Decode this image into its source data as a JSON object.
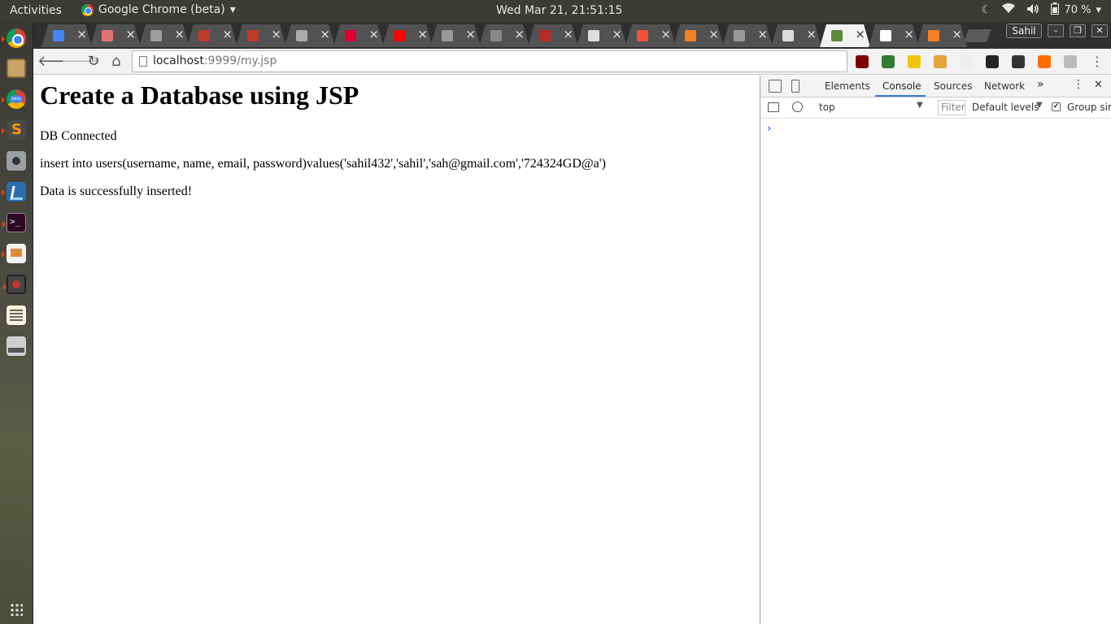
{
  "topbar": {
    "activities": "Activities",
    "app_name": "Google Chrome (beta)",
    "app_menu_arrow": "▾",
    "clock": "Wed Mar 21, 21:51:15",
    "battery": "70 %",
    "tray_arrow": "▾"
  },
  "launcher": {
    "icons": [
      "chrome-icon",
      "files-icon",
      "chrome-beta-icon",
      "sublime-text-icon",
      "camera-icon",
      "vscode-icon",
      "terminal-icon",
      "document-viewer-icon",
      "screen-recorder-icon",
      "text-editor-icon",
      "scanner-icon",
      "show-applications-icon"
    ]
  },
  "browser": {
    "profile_name": "Sahil",
    "tab_close": "×",
    "tabs": [
      {
        "icon": "google-icon",
        "color": "#4285f4"
      },
      {
        "icon": "target-icon",
        "color": "#e57373"
      },
      {
        "icon": "page-icon",
        "color": "#9e9e9e"
      },
      {
        "icon": "netbeans-icon",
        "color": "#c0392b"
      },
      {
        "icon": "netbeans-icon",
        "color": "#c0392b"
      },
      {
        "icon": "vector-icon",
        "color": "#aaaaaa"
      },
      {
        "icon": "angular-icon",
        "color": "#dd0031"
      },
      {
        "icon": "youtube-icon",
        "color": "#ff0000"
      },
      {
        "icon": "codepen-icon",
        "color": "#999999"
      },
      {
        "icon": "spotify-icon",
        "color": "#888888"
      },
      {
        "icon": "quora-icon",
        "color": "#b92b27"
      },
      {
        "icon": "page-icon",
        "color": "#dddddd"
      },
      {
        "icon": "swift-icon",
        "color": "#f05138"
      },
      {
        "icon": "stackoverflow-icon",
        "color": "#f48024"
      },
      {
        "icon": "codepen-icon",
        "color": "#999999"
      },
      {
        "icon": "page-icon",
        "color": "#dddddd"
      },
      {
        "icon": "image-icon",
        "color": "#5d8b3a",
        "active": true
      },
      {
        "icon": "github-icon",
        "color": "#ffffff"
      },
      {
        "icon": "stackoverflow-icon",
        "color": "#f48024"
      }
    ],
    "url_host": "localhost",
    "url_rest": ":9999/my.jsp",
    "extensions": [
      {
        "icon": "ublock-icon",
        "color": "#800000"
      },
      {
        "icon": "color-picker-icon",
        "color": "#2e7d32"
      },
      {
        "icon": "wappalyzer-icon",
        "color": "#f1c40f"
      },
      {
        "icon": "box-icon",
        "color": "#e6a23c"
      },
      {
        "icon": "circle-icon",
        "color": "#eeeeee"
      },
      {
        "icon": "fist-icon",
        "color": "#222222"
      },
      {
        "icon": "archive-icon",
        "color": "#333333"
      },
      {
        "icon": "basketball-icon",
        "color": "#ff6d00"
      },
      {
        "icon": "check-icon",
        "color": "#bbbbbb"
      }
    ]
  },
  "page": {
    "heading": "Create a Database using JSP",
    "status": "DB Connected",
    "query": "insert into users(username, name, email, password)values('sahil432','sahil','sah@gmail.com','724324GD@a')",
    "result": "Data is successfully inserted!"
  },
  "devtools": {
    "tabs": [
      "Elements",
      "Console",
      "Sources",
      "Network"
    ],
    "active_tab": "Console",
    "more_tabs": "»",
    "menu": "⋮",
    "close": "✕",
    "context": "top",
    "filter_placeholder": "Filter",
    "levels": "Default levels",
    "dropdown_arrow": "▼",
    "group_similar": "Group similar",
    "group_checked": "✔",
    "prompt": "›"
  },
  "colors": {
    "accent": "#3879d9",
    "topbar_bg": "#3c3b37",
    "tabstrip_bg": "#2f2f2f"
  }
}
